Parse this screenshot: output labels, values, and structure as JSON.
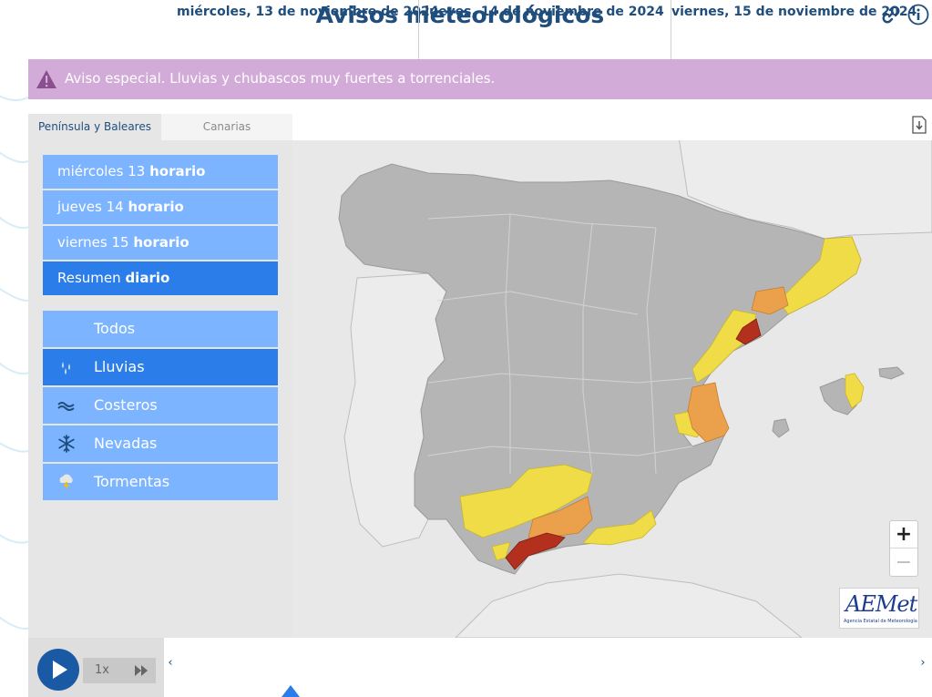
{
  "header": {
    "title": "Avisos meteorológicos",
    "link_icon": "link-icon",
    "info_icon": "info-icon"
  },
  "banner": {
    "icon": "warning-icon",
    "text": "Aviso especial. Lluvias y chubascos muy fuertes a torrenciales."
  },
  "region_tabs": [
    {
      "label": "Península y Baleares",
      "active": true
    },
    {
      "label": "Canarias",
      "active": false
    }
  ],
  "day_buttons": [
    {
      "prefix": "miércoles 13",
      "suffix": "horario",
      "active": false
    },
    {
      "prefix": "jueves 14",
      "suffix": "horario",
      "active": false
    },
    {
      "prefix": "viernes 15",
      "suffix": "horario",
      "active": false
    },
    {
      "prefix": "Resumen",
      "suffix": "diario",
      "active": true
    }
  ],
  "type_buttons": [
    {
      "label": "Todos",
      "icon": "",
      "active": false
    },
    {
      "label": "Lluvias",
      "icon": "rain-icon",
      "active": true
    },
    {
      "label": "Costeros",
      "icon": "waves-icon",
      "active": false
    },
    {
      "label": "Nevadas",
      "icon": "snowflake-icon",
      "active": false
    },
    {
      "label": "Tormentas",
      "icon": "storm-icon",
      "active": false
    }
  ],
  "map": {
    "download_icon": "download-icon",
    "zoom_in": "+",
    "zoom_out": "−",
    "warning_colors": {
      "yellow": "#f0dc46",
      "orange": "#eba04b",
      "red": "#b4301e"
    }
  },
  "logo": {
    "text": "AEMet",
    "subtitle": "Agencia Estatal de Meteorología"
  },
  "player": {
    "play_icon": "play-icon",
    "speed": "1x",
    "fast_forward_icon": "fast-forward-icon"
  },
  "timeline": {
    "prev": "‹",
    "next": "›",
    "days": [
      "miércoles, 13 de noviembre de 2024",
      "jueves, 14 de noviembre de 2024",
      "viernes, 15 de noviembre de 2024"
    ]
  }
}
